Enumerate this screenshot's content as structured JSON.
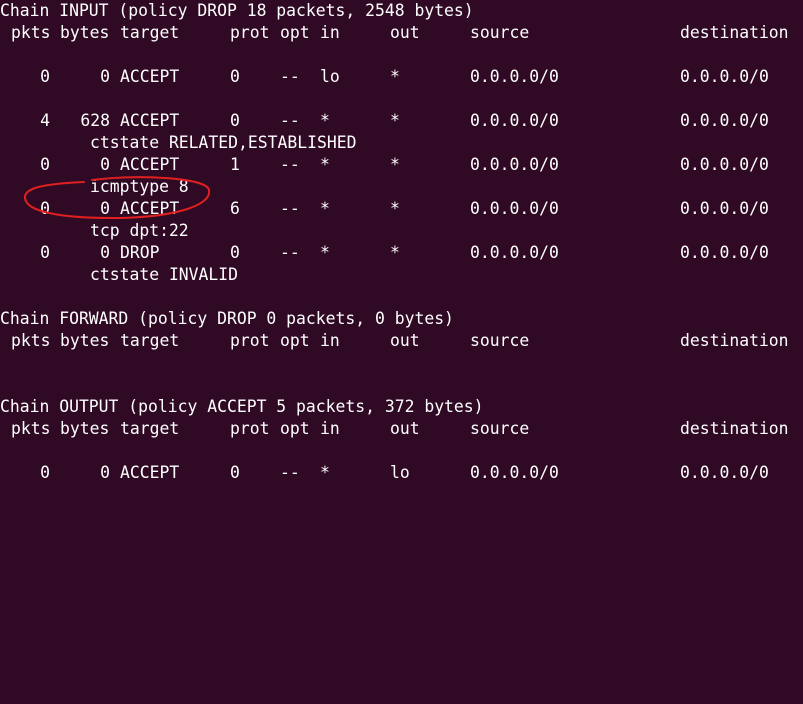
{
  "colors": {
    "background": "#300a24",
    "text": "#ffffff",
    "annotation": "#e02020"
  },
  "header": {
    "pkts": "pkts",
    "bytes": "bytes",
    "target": "target",
    "prot": "prot",
    "opt": "opt",
    "in": "in",
    "out": "out",
    "source": "source",
    "destination": "destination"
  },
  "chains": {
    "input": {
      "title": "Chain INPUT (policy DROP 18 packets, 2548 bytes)",
      "rules": [
        {
          "pkts": "0",
          "bytes": "0",
          "target": "ACCEPT",
          "prot": "0",
          "opt": "--",
          "in": "lo",
          "out": "*",
          "source": "0.0.0.0/0",
          "destination": "0.0.0.0/0",
          "extra": ""
        },
        {
          "pkts": "4",
          "bytes": "628",
          "target": "ACCEPT",
          "prot": "0",
          "opt": "--",
          "in": "*",
          "out": "*",
          "source": "0.0.0.0/0",
          "destination": "0.0.0.0/0",
          "extra": "ctstate RELATED,ESTABLISHED"
        },
        {
          "pkts": "0",
          "bytes": "0",
          "target": "ACCEPT",
          "prot": "1",
          "opt": "--",
          "in": "*",
          "out": "*",
          "source": "0.0.0.0/0",
          "destination": "0.0.0.0/0",
          "extra": "icmptype 8"
        },
        {
          "pkts": "0",
          "bytes": "0",
          "target": "ACCEPT",
          "prot": "6",
          "opt": "--",
          "in": "*",
          "out": "*",
          "source": "0.0.0.0/0",
          "destination": "0.0.0.0/0",
          "extra": "tcp dpt:22"
        },
        {
          "pkts": "0",
          "bytes": "0",
          "target": "DROP",
          "prot": "0",
          "opt": "--",
          "in": "*",
          "out": "*",
          "source": "0.0.0.0/0",
          "destination": "0.0.0.0/0",
          "extra": "ctstate INVALID"
        }
      ]
    },
    "forward": {
      "title": "Chain FORWARD (policy DROP 0 packets, 0 bytes)"
    },
    "output": {
      "title": "Chain OUTPUT (policy ACCEPT 5 packets, 372 bytes)",
      "rules": [
        {
          "pkts": "0",
          "bytes": "0",
          "target": "ACCEPT",
          "prot": "0",
          "opt": "--",
          "in": "*",
          "out": "lo",
          "source": "0.0.0.0/0",
          "destination": "0.0.0.0/0"
        }
      ]
    }
  }
}
